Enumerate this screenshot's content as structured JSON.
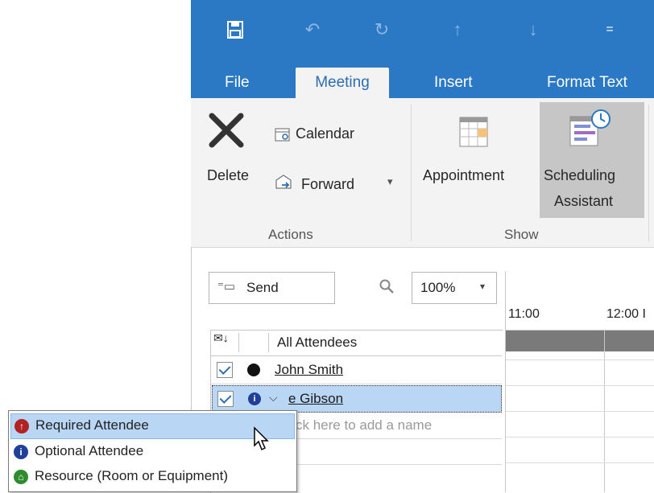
{
  "qat": {
    "icons": [
      "save-icon",
      "undo-icon",
      "redo-icon",
      "up-arrow-icon",
      "down-arrow-icon",
      "customize-icon"
    ]
  },
  "tabs": [
    "File",
    "Meeting",
    "Insert",
    "Format Text"
  ],
  "ribbon": {
    "actions": {
      "delete": "Delete",
      "calendar": "Calendar",
      "forward": "Forward",
      "group": "Actions"
    },
    "show": {
      "appointment": "Appointment",
      "scheduling_line1": "Scheduling",
      "scheduling_line2": "Assistant",
      "group": "Show"
    }
  },
  "toolbar": {
    "send": "Send",
    "zoom": "100%"
  },
  "timeline": {
    "times": [
      "11:00",
      "12:00 I"
    ]
  },
  "attendees": {
    "header": "All Attendees",
    "rows": [
      {
        "name": "John Smith",
        "checked": true
      },
      {
        "name": "e Gibson",
        "checked": true
      }
    ],
    "add_placeholder": "ck here to add a name"
  },
  "popup": {
    "items": [
      {
        "label": "Required Attendee",
        "color": "#b22222"
      },
      {
        "label": "Optional Attendee",
        "color": "#1f3f99"
      },
      {
        "label": "Resource (Room or Equipment)",
        "color": "#2e8b2e"
      }
    ]
  },
  "colors": {
    "title_bar": "#2b78c5",
    "ribbon_bg": "#f3f3f3",
    "selected_row": "#b9d7f5",
    "busy_bar": "#7a7a7a"
  }
}
